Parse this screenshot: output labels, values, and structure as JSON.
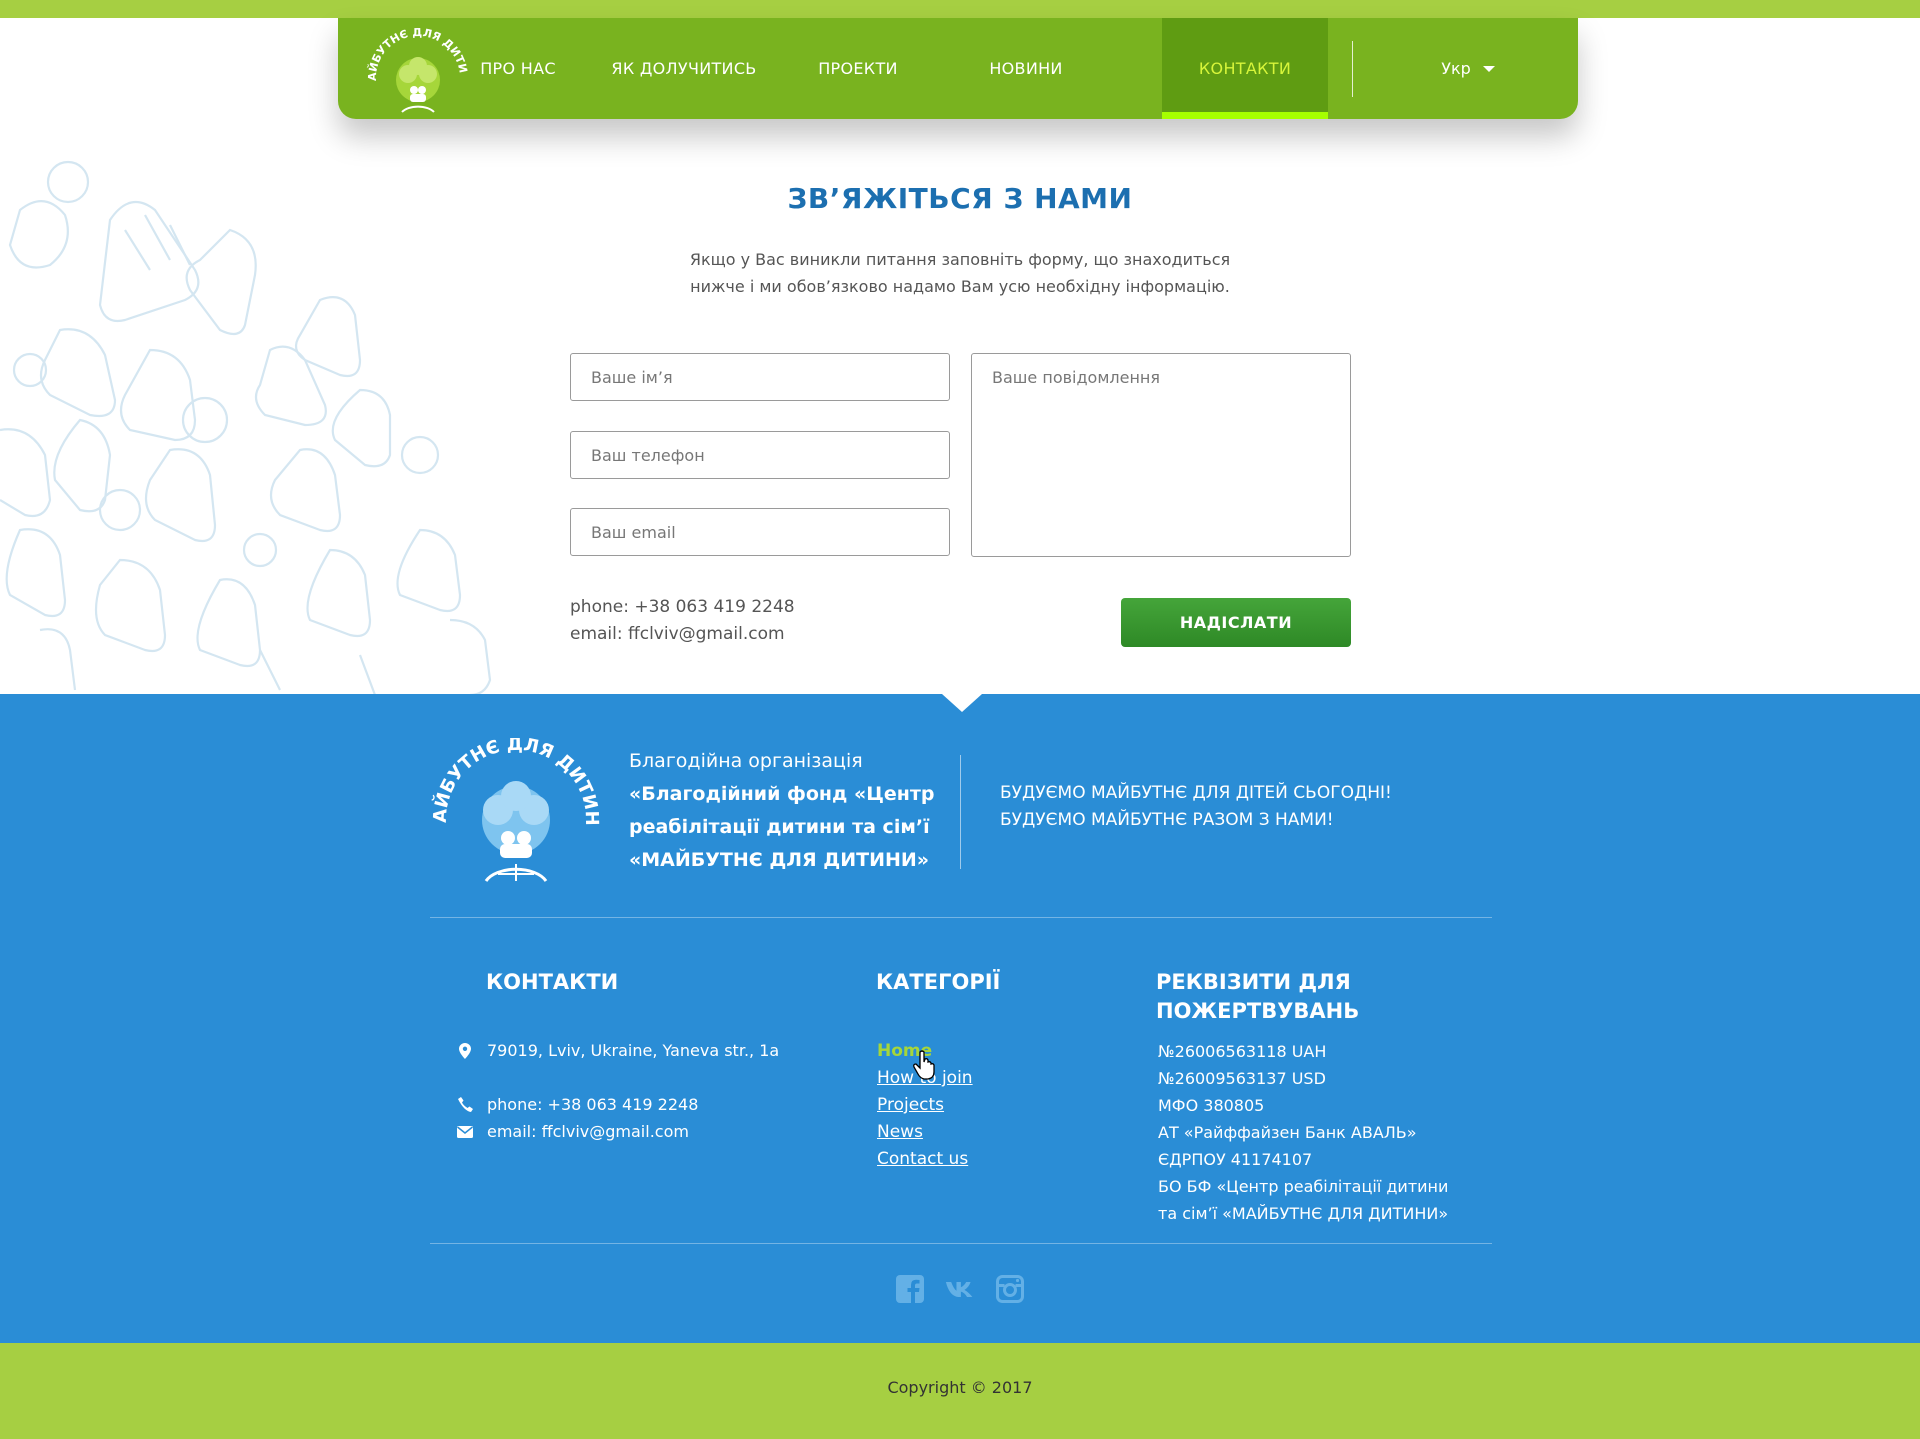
{
  "nav": {
    "items": [
      {
        "label": "ПРО НАС"
      },
      {
        "label": "ЯК ДОЛУЧИТИСЬ"
      },
      {
        "label": "ПРОЕКТИ"
      },
      {
        "label": "НОВИНИ"
      },
      {
        "label": "КОНТАКТИ"
      }
    ],
    "active_index": 4,
    "lang": "Укр"
  },
  "contact": {
    "title": "ЗВ’ЯЖІТЬСЯ З НАМИ",
    "intro_line1": "Якщо у Вас виникли питання заповніть форму, що знаходиться",
    "intro_line2": "нижче і ми обов’язково надамо Вам усю необхідну інформацію.",
    "name_placeholder": "Ваше ім’я",
    "phone_placeholder": "Ваш телефон",
    "email_placeholder": "Ваш email",
    "message_placeholder": "Ваше повідомлення",
    "phone": "phone: +38 063 419 2248",
    "email": "email: ffclviv@gmail.com",
    "send_label": "НАДІСЛАТИ"
  },
  "footer": {
    "org_line1": "Благодійна організація",
    "org_line2": "«Благодійний фонд «Центр",
    "org_line3": "реабілітації дитини та сім’ї",
    "org_line4": "«МАЙБУТНЄ ДЛЯ ДИТИНИ»",
    "slogan1": "БУДУЄМО МАЙБУТНЄ ДЛЯ ДІТЕЙ СЬОГОДНІ!",
    "slogan2": "БУДУЄМО МАЙБУТНЄ РАЗОМ З НАМИ!",
    "contacts_title": "КОНТАКТИ",
    "address": "79019, Lviv, Ukraine, Yaneva str., 1a",
    "phone": "phone: +38 063 419 2248",
    "email": "email: ffclviv@gmail.com",
    "categories_title": "КАТЕГОРІЇ",
    "categories": [
      "Home",
      "How to join",
      "Projects",
      "News",
      "Contact us"
    ],
    "requisites_title_line1": "РЕКВІЗИТИ ДЛЯ",
    "requisites_title_line2": "ПОЖЕРТВУВАНЬ",
    "requisites": "№26006563118  UAH\n№26009563137 USD\nМФО 380805\nАТ «Райффайзен Банк АВАЛЬ»\nЄДРПОУ 41174107\nБО БФ «Центр реабілітації дитини\nта сім’ї «МАЙБУТНЄ ДЛЯ ДИТИНИ»",
    "social": [
      "facebook-icon",
      "vk-icon",
      "instagram-icon"
    ],
    "copyright": "Copyright © 2017"
  },
  "logo_text": "МАЙБУТНЄ ДЛЯ ДИТИНИ",
  "colors": {
    "nav_green": "#79b31f",
    "active_green": "#5f9c12",
    "accent_lime": "#a6cf42",
    "footer_blue": "#2a8dd6",
    "title_blue": "#1c6fb0",
    "button_green": "#3a9a30"
  }
}
